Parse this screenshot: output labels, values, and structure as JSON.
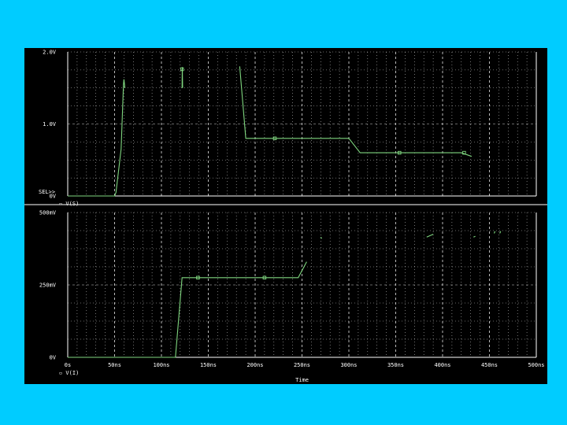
{
  "colors": {
    "background": "#00ccff",
    "screen": "#000000",
    "trace": "#7fd67f",
    "grid": "#ffffff",
    "text": "#ffffff"
  },
  "chart_data": [
    {
      "type": "line",
      "ylim": [
        0,
        2.0
      ],
      "y_tick_values": [
        0,
        1.0,
        2.0
      ],
      "y_tick_labels": [
        "0V",
        "1.0V",
        "2.0V"
      ],
      "marker_label": "SEL>>",
      "legend": "▫ V(S)",
      "grid": true,
      "series": [
        {
          "name": "V(S)",
          "points": [
            [
              0,
              0
            ],
            [
              50,
              0
            ],
            [
              51.5,
              0.05
            ],
            [
              57,
              0.65
            ],
            [
              59.5,
              1.55
            ],
            [
              60,
              1.62
            ],
            [
              61,
              1.5
            ],
            [
              122,
              1.5
            ],
            [
              122.3,
              1.79
            ],
            [
              122.6,
              1.5
            ],
            [
              183,
              1.5
            ],
            [
              183.5,
              1.8
            ],
            [
              190,
              0.8
            ],
            [
              300,
              0.8
            ],
            [
              312,
              0.6
            ],
            [
              420,
              0.6
            ],
            [
              431,
              0.55
            ]
          ],
          "breaks": [
            61,
            122.6,
            183
          ],
          "markers": [
            [
              122,
              1.76
            ],
            [
              221,
              0.8
            ],
            [
              354,
              0.6
            ],
            [
              423,
              0.6
            ]
          ]
        }
      ]
    },
    {
      "type": "line",
      "ylim": [
        0,
        500
      ],
      "y_tick_values": [
        0,
        250,
        500
      ],
      "y_tick_labels": [
        "0V",
        "250mV",
        "500mV"
      ],
      "legend": "▫ V(I)",
      "xlabel": "Time",
      "x_tick_values": [
        0,
        50,
        100,
        150,
        200,
        250,
        300,
        350,
        400,
        450,
        500
      ],
      "x_tick_labels": [
        "0s",
        "50ns",
        "100ns",
        "150ns",
        "200ns",
        "250ns",
        "300ns",
        "350ns",
        "400ns",
        "450ns",
        "500ns"
      ],
      "grid": true,
      "series": [
        {
          "name": "V(I)",
          "points": [
            [
              0,
              0
            ],
            [
              115,
              0
            ],
            [
              122,
              275
            ],
            [
              246,
              275
            ],
            [
              255,
              330
            ],
            [
              269,
              420
            ]
          ],
          "breaks": [
            255
          ],
          "fragments": [
            [
              [
                270,
                415
              ],
              [
                271,
                410
              ]
            ],
            [
              [
                433,
                415
              ],
              [
                435,
                418
              ]
            ],
            [
              [
                383,
                415
              ],
              [
                390,
                425
              ]
            ],
            [
              [
                455,
                428
              ],
              [
                456,
                435
              ]
            ],
            [
              [
                461,
                428
              ],
              [
                462,
                435
              ]
            ]
          ],
          "markers": [
            [
              139,
              275
            ],
            [
              210,
              275
            ]
          ]
        }
      ]
    }
  ]
}
